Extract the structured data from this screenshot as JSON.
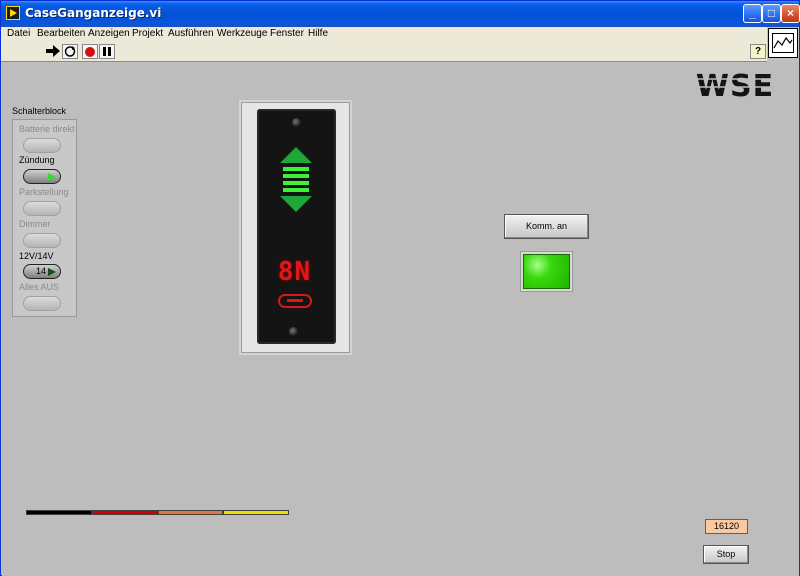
{
  "window": {
    "title": "CaseGanganzeige.vi"
  },
  "menu": {
    "items": [
      "Datei",
      "Bearbeiten",
      "Anzeigen",
      "Projekt",
      "Ausführen",
      "Werkzeuge",
      "Fenster",
      "Hilfe"
    ]
  },
  "toolbar": {
    "icons": [
      "run-arrow-icon",
      "run-continuously-icon",
      "abort-icon",
      "pause-icon",
      "context-help-icon"
    ],
    "help_glyph": "?"
  },
  "logo": {
    "text": "WSE"
  },
  "switch_block": {
    "title": "Schalterblock",
    "items": [
      {
        "label": "Batterie direkt",
        "enabled": false,
        "state": "off"
      },
      {
        "label": "Zündung",
        "enabled": true,
        "state": "on"
      },
      {
        "label": "Parkstellung",
        "enabled": false,
        "state": "off"
      },
      {
        "label": "Dimmer",
        "enabled": false,
        "state": "off"
      },
      {
        "label": "12V/14V",
        "enabled": true,
        "state": "14",
        "value_text": "14"
      },
      {
        "label": "Alles AUS",
        "enabled": false,
        "state": "off"
      }
    ]
  },
  "gear_indicator": {
    "gear_text": "8N",
    "arrow_up_color": "#1fa83a",
    "arrow_down_color": "#1fa83a",
    "bars_lit": 4,
    "bar_color": "#3cf03c",
    "display_color": "#e01818"
  },
  "comm": {
    "button_label": "Komm. an",
    "led_state": "on",
    "led_color": "#38d80c"
  },
  "color_bar": {
    "segments": [
      "#000000",
      "#d40000",
      "#e07840",
      "#f0e000"
    ]
  },
  "counter": {
    "value": "16120"
  },
  "stop_button": {
    "label": "Stop"
  }
}
